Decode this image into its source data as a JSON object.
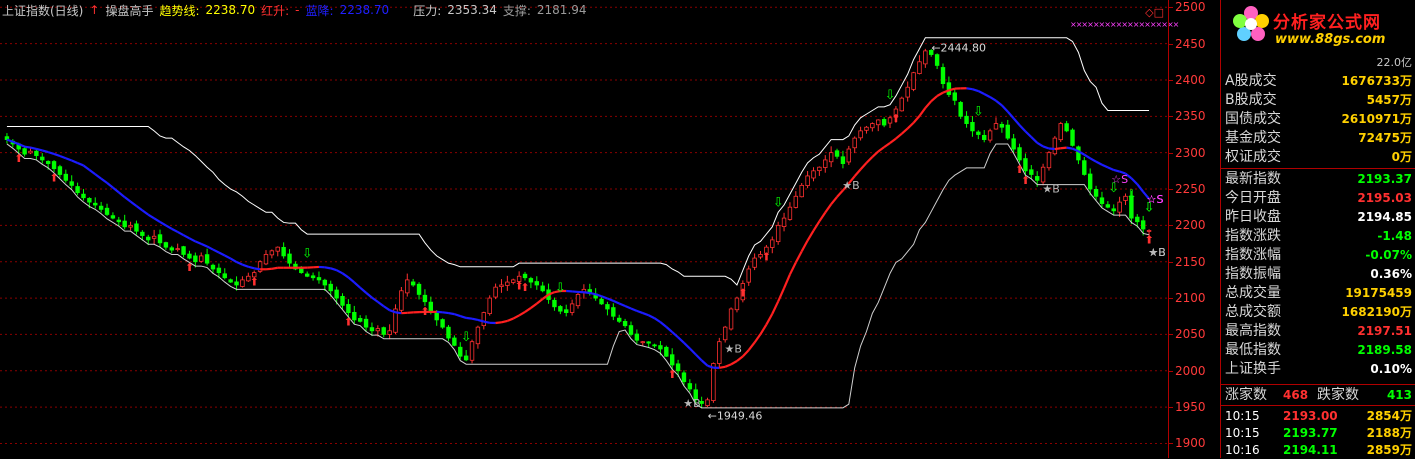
{
  "header": {
    "index_name": "上证指数(日线)",
    "indicator_name": "操盘高手",
    "trend_label": "趋势线:",
    "trend_value": "2238.70",
    "rise_label": "红升:",
    "rise_value": "-",
    "fall_label": "蓝降:",
    "fall_value": "2238.70",
    "pressure_label": "压力:",
    "pressure_value": "2353.34",
    "support_label": "支撑:",
    "support_value": "2181.94"
  },
  "chart_data": {
    "type": "candlestick",
    "ylim": [
      1880,
      2510
    ],
    "yticks": [
      1900,
      1950,
      2000,
      2050,
      2100,
      2150,
      2200,
      2250,
      2300,
      2350,
      2400,
      2450,
      2500
    ],
    "grid": "horizontal dotted",
    "closes": [
      2318,
      2312,
      2305,
      2298,
      2302,
      2296,
      2290,
      2285,
      2278,
      2270,
      2262,
      2255,
      2245,
      2238,
      2232,
      2228,
      2222,
      2215,
      2210,
      2205,
      2198,
      2200,
      2192,
      2186,
      2180,
      2185,
      2176,
      2170,
      2166,
      2168,
      2160,
      2155,
      2150,
      2158,
      2148,
      2140,
      2135,
      2128,
      2122,
      2118,
      2125,
      2130,
      2135,
      2150,
      2160,
      2165,
      2170,
      2158,
      2148,
      2140,
      2135,
      2130,
      2128,
      2125,
      2118,
      2110,
      2100,
      2090,
      2080,
      2070,
      2068,
      2060,
      2055,
      2058,
      2050,
      2055,
      2085,
      2110,
      2125,
      2118,
      2105,
      2095,
      2080,
      2070,
      2060,
      2045,
      2035,
      2020,
      2015,
      2040,
      2060,
      2080,
      2100,
      2115,
      2118,
      2122,
      2125,
      2130,
      2128,
      2122,
      2118,
      2110,
      2098,
      2088,
      2082,
      2080,
      2092,
      2105,
      2112,
      2108,
      2100,
      2092,
      2085,
      2075,
      2068,
      2062,
      2050,
      2042,
      2040,
      2038,
      2035,
      2030,
      2020,
      2008,
      2000,
      1985,
      1975,
      1960,
      1955,
      1960,
      2010,
      2040,
      2060,
      2085,
      2100,
      2120,
      2140,
      2155,
      2160,
      2170,
      2180,
      2200,
      2210,
      2225,
      2240,
      2255,
      2268,
      2275,
      2280,
      2290,
      2300,
      2295,
      2285,
      2305,
      2320,
      2330,
      2335,
      2340,
      2345,
      2338,
      2348,
      2360,
      2375,
      2390,
      2410,
      2425,
      2440,
      2435,
      2420,
      2395,
      2380,
      2372,
      2350,
      2340,
      2330,
      2325,
      2318,
      2330,
      2340,
      2335,
      2320,
      2305,
      2290,
      2275,
      2270,
      2262,
      2280,
      2300,
      2320,
      2340,
      2330,
      2310,
      2290,
      2270,
      2250,
      2240,
      2230,
      2225,
      2220,
      2232,
      2240,
      2210,
      2205,
      2195,
      2193
    ],
    "markers": {
      "buy_arrows_day": [
        2,
        8,
        31,
        42,
        58,
        71,
        87,
        88,
        113,
        125,
        129,
        151,
        172,
        173,
        199,
        203,
        207,
        220
      ],
      "sell_arrows_day": [
        51,
        78,
        94,
        131,
        150,
        165,
        188,
        191,
        213,
        231
      ],
      "star_b": [
        {
          "label": "★B",
          "day": 115
        },
        {
          "label": "★B",
          "day": 122
        },
        {
          "label": "★B",
          "day": 142
        },
        {
          "label": "★B",
          "day": 176
        },
        {
          "label": "★B",
          "day": 243
        },
        {
          "label": "★B",
          "day": 248
        },
        {
          "label": "★B",
          "day": 264
        }
      ],
      "star_s": [
        {
          "label": "☆S",
          "day": 188
        },
        {
          "label": "☆S",
          "day": 194
        },
        {
          "label": "☆S",
          "day": 201
        },
        {
          "label": "☆S",
          "day": 233
        }
      ]
    },
    "annotations": [
      {
        "text": "1949.46",
        "value": 1949.46
      },
      {
        "text": "2444.80",
        "value": 2444.8
      }
    ]
  },
  "panel": {
    "logo_title": "分析家公式网",
    "logo_url": "www.88gs.com",
    "volume_text": "22.0亿",
    "rows": [
      {
        "label": "A股成交",
        "value": "1676733万",
        "color": "#ffd000"
      },
      {
        "label": "B股成交",
        "value": "5457万",
        "color": "#ffd000"
      },
      {
        "label": "国债成交",
        "value": "2610971万",
        "color": "#ffd000"
      },
      {
        "label": "基金成交",
        "value": "72475万",
        "color": "#ffd000"
      },
      {
        "label": "权证成交",
        "value": "0万",
        "color": "#ffd000"
      },
      {
        "label": "最新指数",
        "value": "2193.37",
        "color": "#00ff00"
      },
      {
        "label": "今日开盘",
        "value": "2195.03",
        "color": "#ff3030"
      },
      {
        "label": "昨日收盘",
        "value": "2194.85",
        "color": "#ffffff"
      },
      {
        "label": "指数涨跌",
        "value": "-1.48",
        "color": "#00ff00"
      },
      {
        "label": "指数涨幅",
        "value": "-0.07%",
        "color": "#00ff00"
      },
      {
        "label": "指数振幅",
        "value": "0.36%",
        "color": "#ffffff"
      },
      {
        "label": "总成交量",
        "value": "19175459",
        "color": "#ffd000"
      },
      {
        "label": "总成交额",
        "value": "1682190万",
        "color": "#ffd000"
      },
      {
        "label": "最高指数",
        "value": "2197.51",
        "color": "#ff3030"
      },
      {
        "label": "最低指数",
        "value": "2189.58",
        "color": "#00ff00"
      },
      {
        "label": "上证换手",
        "value": "0.10%",
        "color": "#ffffff"
      }
    ],
    "up_label": "涨家数",
    "up_value": "468",
    "down_label": "跌家数",
    "down_value": "413",
    "ticks": [
      {
        "time": "10:15",
        "price": "2193.00",
        "vol": "2854万"
      },
      {
        "time": "10:15",
        "price": "2193.77",
        "vol": "2188万"
      },
      {
        "time": "10:16",
        "price": "2194.11",
        "vol": "2859万"
      }
    ]
  },
  "colors": {
    "up": "#ff3030",
    "down": "#00ff00",
    "trend_red": "#ff2020",
    "trend_blue": "#1c1cff",
    "pressure": "#ffffff",
    "grid": "#8a0000"
  }
}
